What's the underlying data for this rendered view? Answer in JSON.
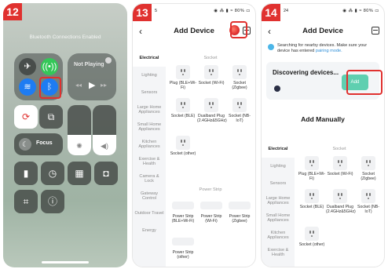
{
  "phone12": {
    "badge": "12",
    "banner": "Bluetooth Connections Enabled",
    "now_playing": "Not Playing",
    "focus_label": "Focus"
  },
  "phone13": {
    "badge": "13",
    "status_time": "5",
    "status_icons": "◉ ⁂ ▮ ≈ 80% ▭",
    "title": "Add Device",
    "categories": [
      "Electrical",
      "Lighting",
      "Sensors",
      "Large Home Appliances",
      "Small Home Appliances",
      "Kitchen Appliances",
      "Exercise & Health",
      "Camera & Lock",
      "Gateway Control",
      "Outdoor Travel",
      "Energy"
    ],
    "section_socket": "Socket",
    "section_strip": "Power Strip",
    "socket_devices": [
      "Plug (BLE+Wi-Fi)",
      "Socket (Wi-Fi)",
      "Socket (Zigbee)",
      "Socket (BLE)",
      "Dualband Plug (2.4GHz&5GHz)",
      "Socket (NB-IoT)",
      "Socket (other)"
    ],
    "strip_devices": [
      "Power Strip (BLE+Wi-Fi)",
      "Power Strip (Wi-Fi)",
      "Power Strip (Zigbee)",
      "Power Strip (other)"
    ]
  },
  "phone14": {
    "badge": "14",
    "status_time": "24",
    "status_icons": "◉ ⁂ ▮ ≈ 80% ▭",
    "title": "Add Device",
    "info_text": "Searching for nearby devices. Make sure your device has entered ",
    "info_link": "pairing mode.",
    "discovering_title": "Discovering devices...",
    "add_button": "Add",
    "add_manually_title": "Add Manually",
    "categories": [
      "Electrical",
      "Lighting",
      "Sensors",
      "Large Home Appliances",
      "Small Home Appliances",
      "Kitchen Appliances",
      "Exercise & Health"
    ],
    "section_socket": "Socket",
    "socket_devices": [
      "Plug (BLE+Wi-Fi)",
      "Socket (Wi-Fi)",
      "Socket (Zigbee)",
      "Socket (BLE)",
      "Dualband Plug (2.4GHz&5GHz)",
      "Socket (NB-IoT)",
      "Socket (other)"
    ]
  }
}
